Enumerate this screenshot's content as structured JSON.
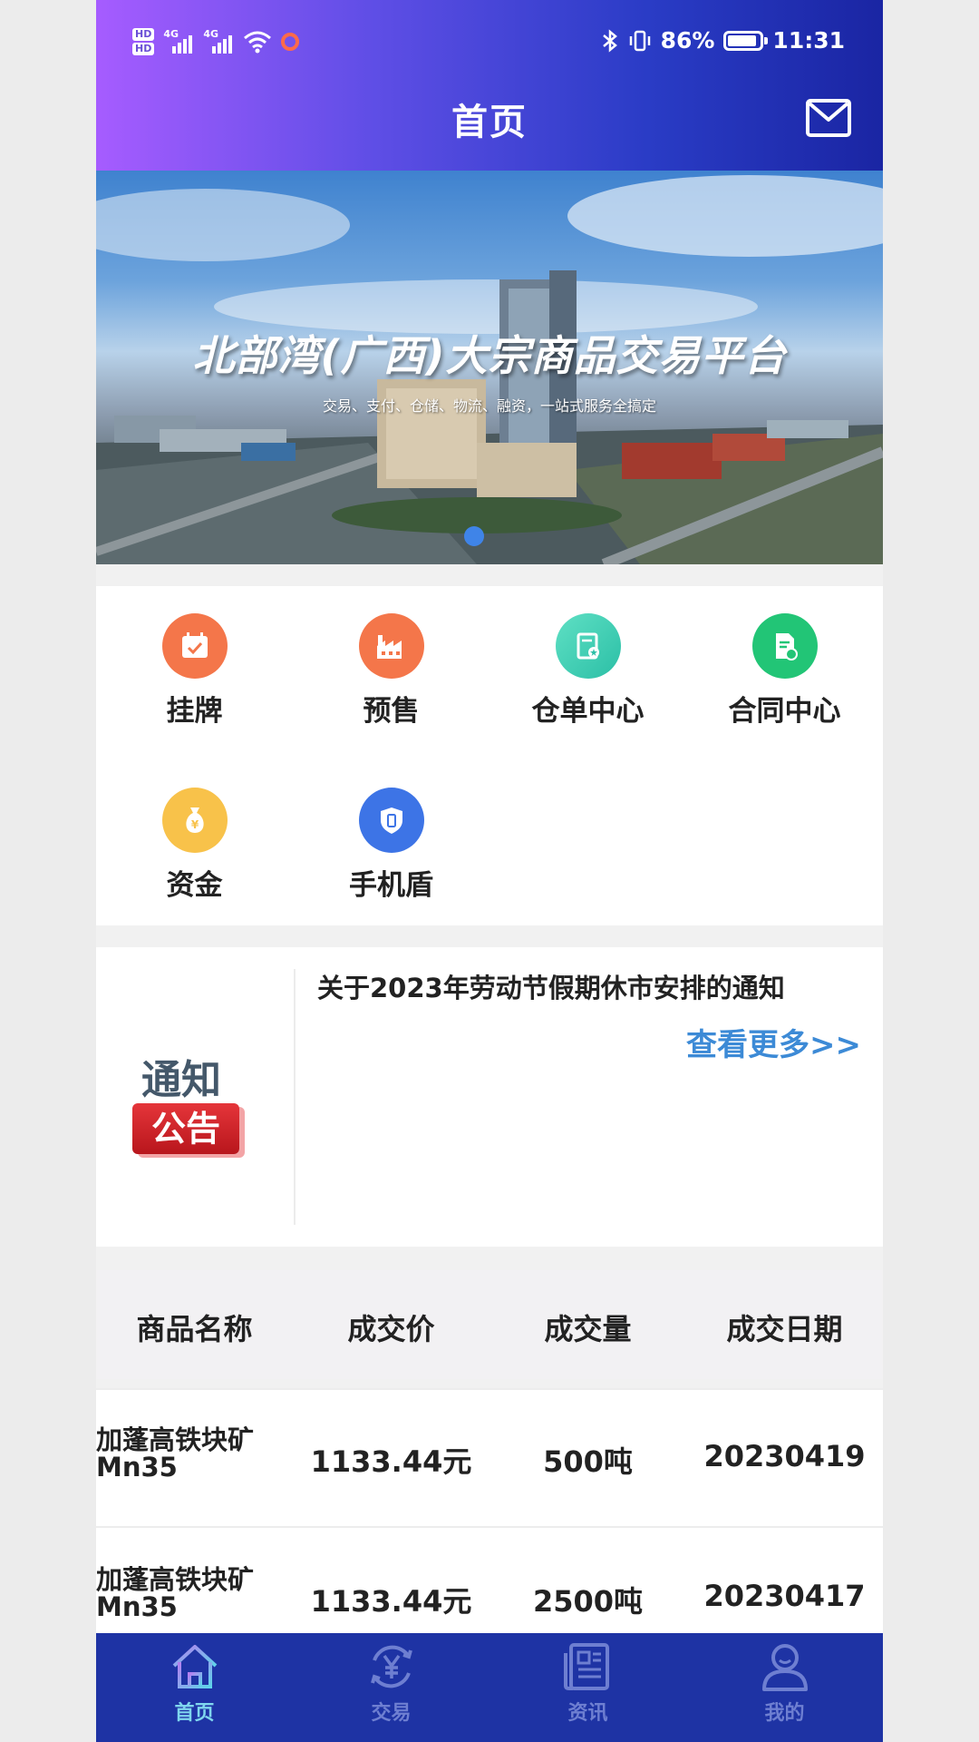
{
  "status_bar": {
    "hd1": "HD",
    "hd2": "HD",
    "net1": "4G",
    "net2": "4G",
    "battery": "86%",
    "battery_level": 0.86,
    "time": "11:31"
  },
  "header": {
    "title": "首页",
    "mail_icon": "mail-icon"
  },
  "banner": {
    "title": "北部湾(广西)大宗商品交易平台",
    "subtitle": "交易、支付、仓储、物流、融资，一站式服务全搞定"
  },
  "menu": {
    "items": [
      {
        "label": "挂牌",
        "icon": "calendar-check-icon",
        "color": "#f4764a"
      },
      {
        "label": "预售",
        "icon": "factory-icon",
        "color": "#f4764a"
      },
      {
        "label": "仓单中心",
        "icon": "warehouse-receipt-icon",
        "color": "#3fd3b7"
      },
      {
        "label": "合同中心",
        "icon": "contract-icon",
        "color": "#22c576"
      },
      {
        "label": "资金",
        "icon": "money-bag-icon",
        "color": "#f8c24a"
      },
      {
        "label": "手机盾",
        "icon": "phone-shield-icon",
        "color": "#3d74e6"
      }
    ]
  },
  "notice": {
    "logo_top": "通知",
    "logo_badge": "公告",
    "title": "关于2023年劳动节假期休市安排的通知",
    "more": "查看更多>>"
  },
  "table": {
    "headers": [
      "商品名称",
      "成交价",
      "成交量",
      "成交日期"
    ],
    "rows": [
      {
        "name": "加蓬高铁块矿Mn35",
        "name_line1": "加蓬高铁块矿",
        "name_line2": "Mn35",
        "price": "1133.44元",
        "volume": "500吨",
        "date": "20230419"
      },
      {
        "name": "加蓬高铁块矿Mn35",
        "name_line1": "加蓬高铁块矿",
        "name_line2": "Mn35",
        "price": "1133.44元",
        "volume": "2500吨",
        "date": "20230417"
      }
    ]
  },
  "tabbar": {
    "items": [
      {
        "label": "首页",
        "icon": "home-icon",
        "active": true
      },
      {
        "label": "交易",
        "icon": "yuen-exchange-icon",
        "active": false
      },
      {
        "label": "资讯",
        "icon": "news-icon",
        "active": false
      },
      {
        "label": "我的",
        "icon": "user-icon",
        "active": false
      }
    ]
  },
  "colors": {
    "header_gradient_start": "#a65cff",
    "header_gradient_end": "#1a25a3",
    "tabbar_bg": "#1e33a4",
    "link_blue": "#3c8ad6",
    "active_tab": "#7fd6ee"
  }
}
